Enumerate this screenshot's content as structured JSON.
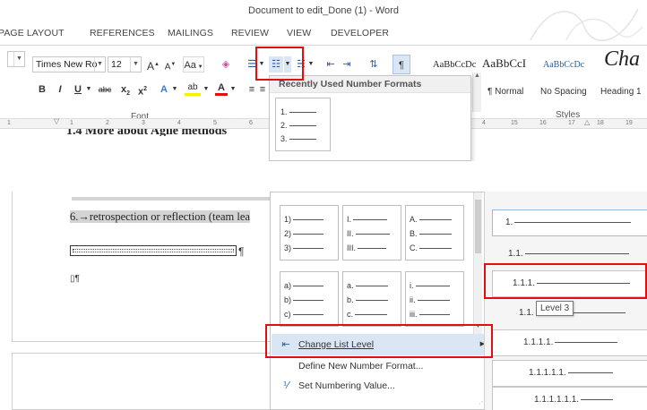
{
  "window": {
    "title": "Document to edit_Done (1) - Word"
  },
  "tabs": [
    "PAGE LAYOUT",
    "REFERENCES",
    "MAILINGS",
    "REVIEW",
    "VIEW",
    "DEVELOPER"
  ],
  "font": {
    "name": "Times New Ro",
    "size": "12",
    "grow": "A",
    "shrink": "A",
    "change_case": "Aa",
    "bold": "B",
    "italic": "I",
    "underline": "U",
    "strike": "abc",
    "sub": "x",
    "super": "x",
    "effects": "A",
    "highlight": "ab",
    "color": "A",
    "group_label": "Font"
  },
  "styles": {
    "items": [
      {
        "sample": "AaBbCcDc",
        "name": "¶ Normal"
      },
      {
        "sample": "AaBbCcI",
        "name": "No Spacing"
      },
      {
        "sample": "AaBbCcDc",
        "name": "Heading 1"
      },
      {
        "sample": "Cha",
        "name": ""
      }
    ],
    "group_label": "Styles"
  },
  "recent_formats": {
    "header": "Recently Used Number Formats",
    "preview": [
      "1.",
      "2.",
      "3."
    ]
  },
  "ruler": {
    "left_ticks": [
      "1",
      "1",
      "2",
      "3",
      "4",
      "5",
      "6"
    ],
    "right_ticks": [
      "4",
      "15",
      "16",
      "17",
      "18",
      "19"
    ]
  },
  "document": {
    "top_line": "1.4 More about Agile methods",
    "item6": "6.→retrospection or reflection (team lea",
    "pilcrow": "¶",
    "marker": "▯¶"
  },
  "library": {
    "cells": [
      [
        "1)",
        "2)",
        "3)"
      ],
      [
        "I.",
        "II.",
        "III."
      ],
      [
        "A.",
        "B.",
        "C."
      ],
      [
        "a)",
        "b)",
        "c)"
      ],
      [
        "a.",
        "b.",
        "c."
      ],
      [
        "i.",
        "ii.",
        "iii."
      ]
    ]
  },
  "list_levels": [
    "1.",
    "1.1.",
    "1.1.1.",
    "1.1.",
    "1.1.1.1.",
    "1.1.1.1.1.",
    "1.1.1.1.1.1."
  ],
  "tooltip": "Level 3",
  "menu": {
    "change_level": "Change List Level",
    "define_new": "Define New Number Format...",
    "set_value": "Set Numbering Value..."
  },
  "colors": {
    "accent": "#2f5d9a",
    "highlight_box": "#e01010",
    "menu_hover": "#dbe6f4"
  }
}
